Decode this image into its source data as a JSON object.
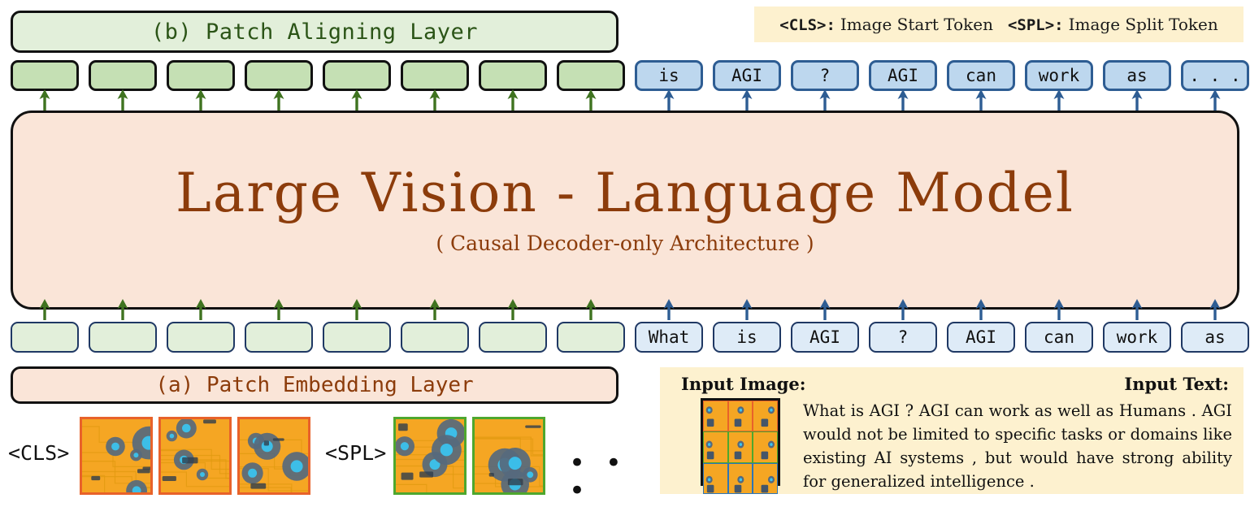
{
  "legend": {
    "entries": [
      {
        "token": "<CLS>:",
        "desc": "Image Start Token"
      },
      {
        "token": "<SPL>:",
        "desc": "Image Split Token"
      }
    ]
  },
  "align_layer": {
    "label": "(b) Patch Aligning Layer"
  },
  "embed_layer": {
    "label": "(a) Patch Embedding Layer"
  },
  "model": {
    "title": "Large  Vision - Language  Model",
    "subtitle": "( Causal Decoder-only Architecture )"
  },
  "output_row": {
    "visual_tokens": [
      "",
      "",
      "",
      "",
      "",
      "",
      "",
      ""
    ],
    "text_tokens": [
      "is",
      "AGI",
      "?",
      "AGI",
      "can",
      "work",
      "as",
      ". . ."
    ]
  },
  "input_row": {
    "visual_tokens": [
      "",
      "",
      "",
      "",
      "",
      "",
      "",
      ""
    ],
    "text_tokens": [
      "What",
      "is",
      "AGI",
      "?",
      "AGI",
      "can",
      "work",
      "as"
    ]
  },
  "patch_strip": {
    "cls_label": "<CLS>",
    "spl_label": "<SPL>",
    "ellipsis": "• • •",
    "patches_group_1": [
      "patch-1",
      "patch-2",
      "patch-3"
    ],
    "patches_group_2": [
      "patch-4",
      "patch-5"
    ]
  },
  "input_panel": {
    "image_label": "Input Image:",
    "text_label": "Input Text:",
    "text": "What is AGI ? AGI can work as well as Humans . AGI would not be limited to specific tasks or domains like existing AI systems , but would have strong ability for generalized intelligence ."
  },
  "colors": {
    "green_fill": "#c5e0b4",
    "green_fill_light": "#e2efda",
    "blue_fill": "#bdd7ee",
    "blue_fill_light": "#deebf7",
    "peach_fill": "#fae5d8",
    "cream_fill": "#fdf1cf",
    "brown_text": "#8c3c0b",
    "dark_green_text": "#2b5417",
    "green_arrow": "#3f7320",
    "blue_arrow": "#2e5d93",
    "border_dark": "#111111",
    "border_navy": "#1f3864",
    "patch_orange": "#e8622a",
    "patch_green": "#4ea72e",
    "patch_blue": "#2e75b6"
  }
}
